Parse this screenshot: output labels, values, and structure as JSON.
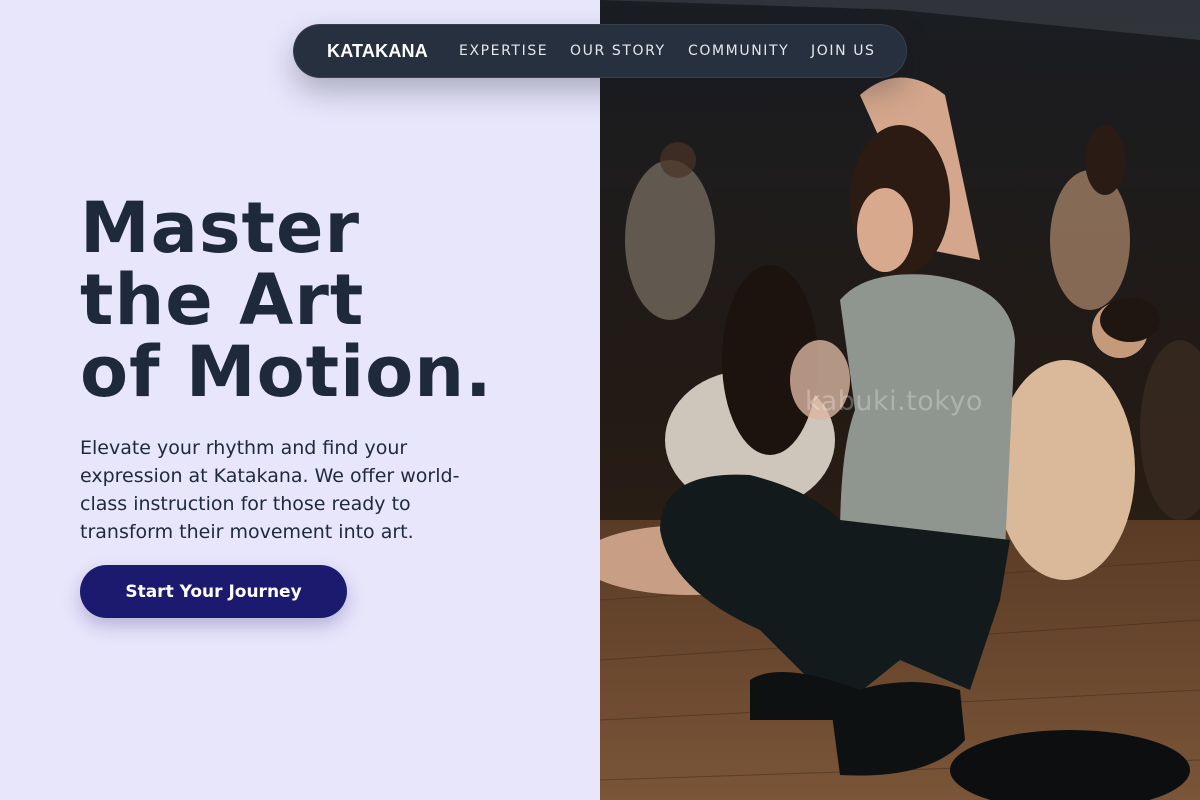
{
  "nav": {
    "logo": "KATAKANA",
    "links": [
      "EXPERTISE",
      "OUR STORY",
      "COMMUNITY",
      "JOIN US"
    ]
  },
  "hero": {
    "title_lines": [
      "Master",
      "the Art",
      "of Motion."
    ],
    "description": "Elevate your rhythm and find your expression at Katakana. We offer world-class instruction for those ready to transform their movement into art.",
    "cta_label": "Start Your Journey"
  },
  "photo": {
    "subject": "dance-studio-photo",
    "watermark": "kabuki.tokyo"
  },
  "colors": {
    "background": "#e8e6fb",
    "heading": "#1e293b",
    "nav_background": "#27303f",
    "cta_background": "#1c1a6e"
  }
}
